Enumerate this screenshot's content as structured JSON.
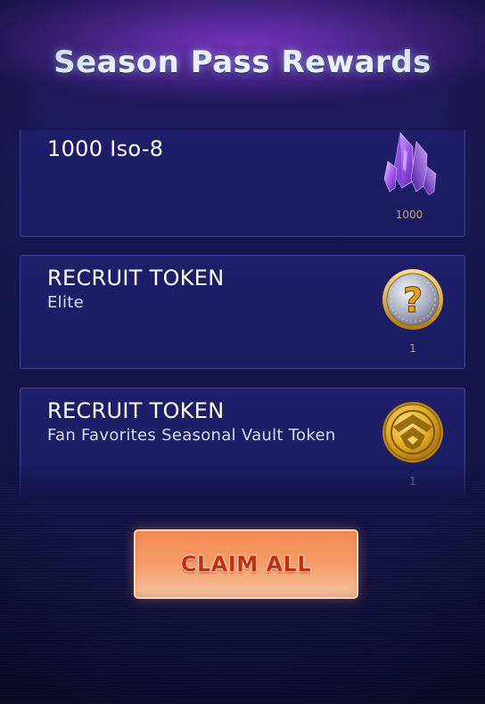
{
  "modal": {
    "title": "Season Pass Rewards"
  },
  "rewards": [
    {
      "title": "1000 Iso-8",
      "subtitle": "",
      "icon": "iso8-crystal-icon",
      "quantity": "1000"
    },
    {
      "title": "RECRUIT TOKEN",
      "subtitle": "Elite",
      "icon": "elite-token-icon",
      "quantity": "1"
    },
    {
      "title": "RECRUIT TOKEN",
      "subtitle": "Fan Favorites Seasonal Vault Token",
      "icon": "shield-token-icon",
      "quantity": "1"
    }
  ],
  "actions": {
    "claim_all_label": "CLAIM ALL"
  },
  "colors": {
    "background": "#1a1856",
    "card": "#1e1e66",
    "card_border": "#3b3c92",
    "button": "#f59a63",
    "button_text": "#c52f0f",
    "quantity_text": "#b9a17f"
  }
}
